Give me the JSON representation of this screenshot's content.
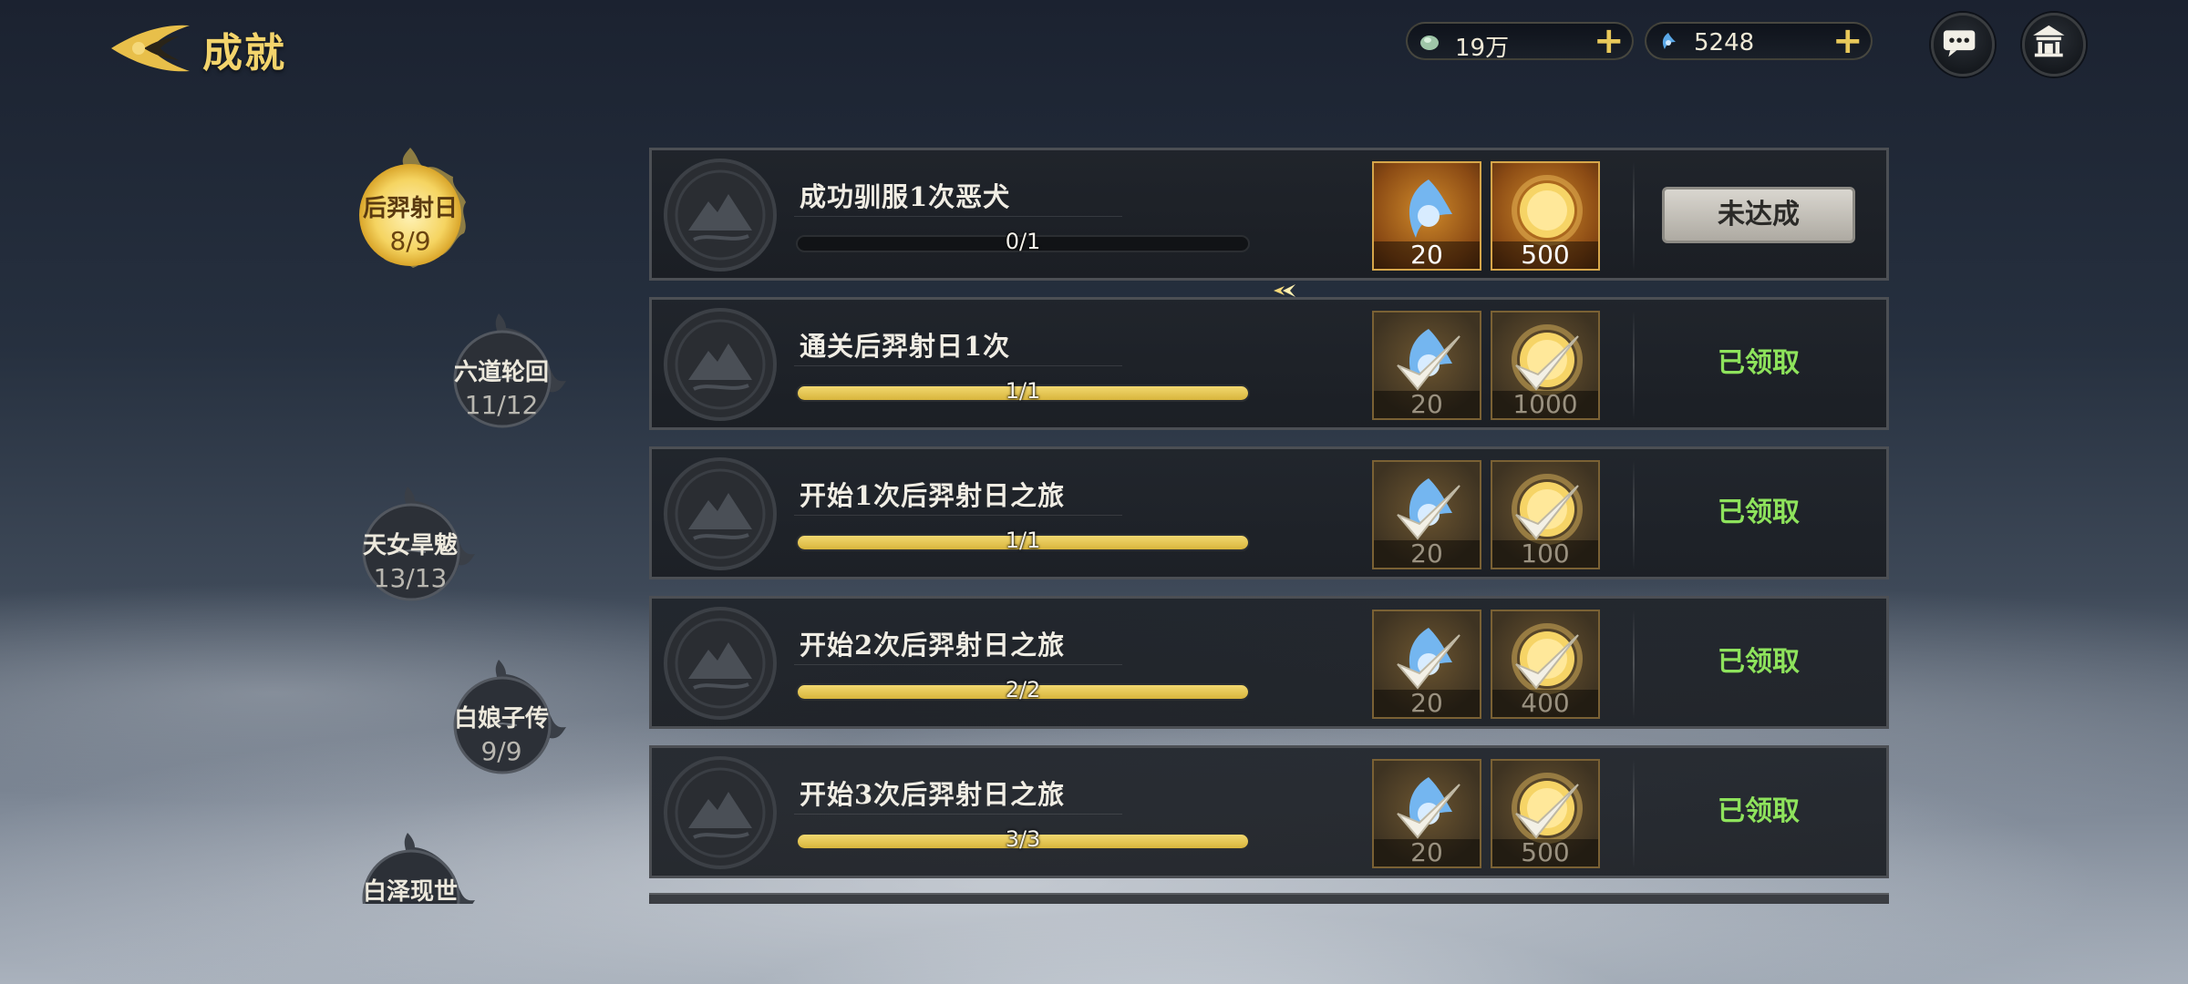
{
  "header": {
    "title": "成就",
    "currencies": [
      {
        "icon": "jade-icon",
        "value": "19万"
      },
      {
        "icon": "spirit-gem-icon",
        "value": "5248"
      }
    ],
    "buttons": [
      "chat-icon",
      "pavilion-icon"
    ]
  },
  "nav": [
    {
      "name": "后羿射日",
      "count": "8/9",
      "active": true
    },
    {
      "name": "六道轮回",
      "count": "11/12"
    },
    {
      "name": "天女旱魃",
      "count": "13/13"
    },
    {
      "name": "白娘子传",
      "count": "9/9"
    },
    {
      "name": "白泽现世",
      "count": ""
    }
  ],
  "achievements": [
    {
      "title": "成功驯服1次恶犬",
      "progress": "0/1",
      "fill": 0,
      "rewards": [
        "20",
        "500"
      ],
      "status": "未达成",
      "claimed": false
    },
    {
      "title": "通关后羿射日1次",
      "progress": "1/1",
      "fill": 1,
      "rewards": [
        "20",
        "1000"
      ],
      "status": "已领取",
      "claimed": true
    },
    {
      "title": "开始1次后羿射日之旅",
      "progress": "1/1",
      "fill": 1,
      "rewards": [
        "20",
        "100"
      ],
      "status": "已领取",
      "claimed": true
    },
    {
      "title": "开始2次后羿射日之旅",
      "progress": "2/2",
      "fill": 1,
      "rewards": [
        "20",
        "400"
      ],
      "status": "已领取",
      "claimed": true
    },
    {
      "title": "开始3次后羿射日之旅",
      "progress": "3/3",
      "fill": 1,
      "rewards": [
        "20",
        "500"
      ],
      "status": "已领取",
      "claimed": true
    }
  ],
  "colors": {
    "accent_gold": "#f3d46c",
    "claimed_green": "#8ee35c",
    "progress_fill": "#e6c650"
  }
}
